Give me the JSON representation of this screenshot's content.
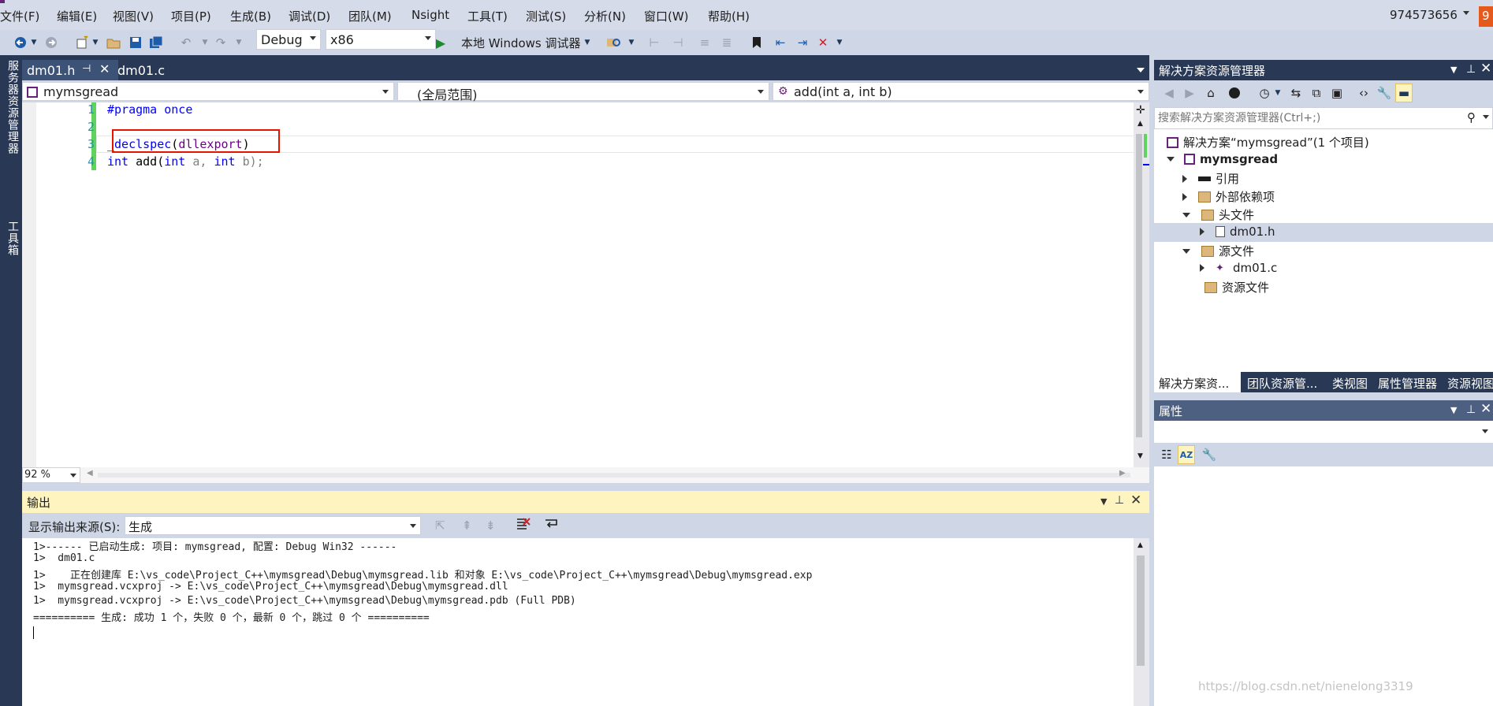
{
  "menu": {
    "items": [
      "文件(F)",
      "编辑(E)",
      "视图(V)",
      "项目(P)",
      "生成(B)",
      "调试(D)",
      "团队(M)",
      "Nsight",
      "工具(T)",
      "测试(S)",
      "分析(N)",
      "窗口(W)",
      "帮助(H)"
    ],
    "user": "974573656",
    "notify_count": "9"
  },
  "toolbar": {
    "config": "Debug",
    "platform": "x86",
    "run_label": "本地 Windows 调试器"
  },
  "side_strip": {
    "server_explorer": "服务器资源管理器",
    "toolbox": "工具箱"
  },
  "doc_tabs": [
    {
      "label": "dm01.h"
    },
    {
      "label": "dm01.c"
    }
  ],
  "nav": {
    "project": "mymsgread",
    "scope": "(全局范围)",
    "member": "add(int a, int b)"
  },
  "editor": {
    "lines": [
      {
        "num": "1",
        "parts": [
          {
            "t": "#pragma once",
            "c": "#0000ff"
          }
        ]
      },
      {
        "num": "2",
        "parts": []
      },
      {
        "num": "3",
        "parts": [
          {
            "t": "_declspec",
            "c": "#0000ff"
          },
          {
            "t": "(",
            "c": "#000000"
          },
          {
            "t": "dllexport",
            "c": "#6f008a"
          },
          {
            "t": ")",
            "c": "#000000"
          }
        ]
      },
      {
        "num": "4",
        "parts": [
          {
            "t": "int",
            "c": "#0000ff"
          },
          {
            "t": " add(",
            "c": "#000000"
          },
          {
            "t": "int",
            "c": "#0000ff"
          },
          {
            "t": " a, ",
            "c": "#808080"
          },
          {
            "t": "int",
            "c": "#0000ff"
          },
          {
            "t": " b);",
            "c": "#808080"
          }
        ]
      }
    ],
    "zoom": "92 %"
  },
  "output": {
    "title": "输出",
    "source_label": "显示输出来源(S):",
    "source_value": "生成",
    "lines": [
      "1>------ 已启动生成: 项目: mymsgread, 配置: Debug Win32 ------",
      "1>  dm01.c",
      "1>    正在创建库 E:\\vs_code\\Project_C++\\mymsgread\\Debug\\mymsgread.lib 和对象 E:\\vs_code\\Project_C++\\mymsgread\\Debug\\mymsgread.exp",
      "1>  mymsgread.vcxproj -> E:\\vs_code\\Project_C++\\mymsgread\\Debug\\mymsgread.dll",
      "1>  mymsgread.vcxproj -> E:\\vs_code\\Project_C++\\mymsgread\\Debug\\mymsgread.pdb (Full PDB)",
      "========== 生成: 成功 1 个，失败 0 个，最新 0 个，跳过 0 个 =========="
    ]
  },
  "solution_explorer": {
    "title": "解决方案资源管理器",
    "search_placeholder": "搜索解决方案资源管理器(Ctrl+;)",
    "solution": "解决方案“mymsgread”(1 个项目)",
    "project": "mymsgread",
    "nodes": {
      "refs": "引用",
      "ext_deps": "外部依赖项",
      "headers": "头文件",
      "dm01h": "dm01.h",
      "sources": "源文件",
      "dm01c": "dm01.c",
      "resources": "资源文件"
    },
    "tabs": [
      "解决方案资...",
      "团队资源管...",
      "类视图",
      "属性管理器",
      "资源视图"
    ]
  },
  "properties": {
    "title": "属性"
  },
  "watermark": "https://blog.csdn.net/nienelong3319",
  "colors": {
    "accent": "#293955",
    "highlight": "#e51400",
    "changed_bar": "#5ed35e",
    "selection": "#cce8ff"
  }
}
